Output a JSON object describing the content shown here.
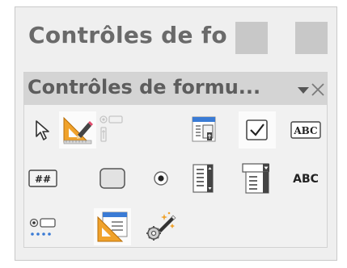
{
  "window": {
    "title": "Contrôles de fo"
  },
  "toolbar": {
    "title": "Contrôles de formu...",
    "dropdown_icon": "triangle-down-icon",
    "close_icon": "close-icon"
  },
  "tools": [
    {
      "icon": "select-pointer-icon"
    },
    {
      "icon": "design-mode-icon",
      "state": "active"
    },
    {
      "icon": "option-button-disabled-icon",
      "state": "disabled"
    },
    {
      "icon": "form-design-icon"
    },
    {
      "icon": "checkbox-icon",
      "state": "active"
    },
    {
      "icon": "text-box-icon",
      "text": "ABC"
    },
    {
      "icon": "formatted-field-icon",
      "text": "##"
    },
    {
      "icon": "push-button-icon"
    },
    {
      "icon": "option-button-icon"
    },
    {
      "icon": "list-box-icon"
    },
    {
      "icon": "combo-box-icon"
    },
    {
      "icon": "label-field-icon",
      "text": "ABC"
    },
    {
      "icon": "more-controls-icon"
    },
    {
      "icon": "form-design-mode-icon"
    },
    {
      "icon": "wizards-icon"
    }
  ],
  "colors": {
    "background": "#efefef",
    "header": "#d4d4d4",
    "design_orange": "#f0a22b",
    "selection": "#3a7bd5"
  }
}
